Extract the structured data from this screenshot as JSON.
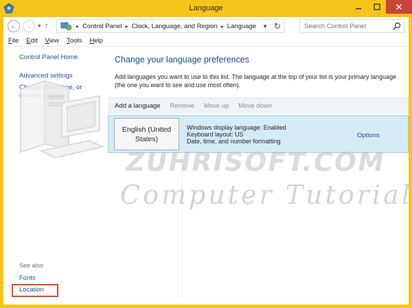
{
  "window": {
    "title": "Language",
    "accent_color": "#f5c518",
    "close_color": "#c7453a"
  },
  "navigation": {
    "breadcrumbs": [
      "Control Panel",
      "Clock, Language, and Region",
      "Language"
    ],
    "search_placeholder": "Search Control Panel"
  },
  "menu": {
    "items": [
      {
        "label": "File",
        "underline": "F",
        "rest": "ile"
      },
      {
        "label": "Edit",
        "underline": "E",
        "rest": "dit"
      },
      {
        "label": "View",
        "underline": "V",
        "rest": "iew"
      },
      {
        "label": "Tools",
        "underline": "T",
        "rest": "ools"
      },
      {
        "label": "Help",
        "underline": "H",
        "rest": "elp"
      }
    ]
  },
  "sidebar": {
    "home": "Control Panel Home",
    "advanced": "Advanced settings",
    "date_time": "Change date, time, or number formats",
    "see_also": "See also",
    "fonts": "Fonts",
    "location": "Location"
  },
  "main": {
    "heading": "Change your language preferences",
    "description": "Add languages you want to use to this list. The language at the top of your list is your primary language (the one you want to see and use most often).",
    "toolbar": {
      "add": "Add a language",
      "remove": "Remove",
      "move_up": "Move up",
      "move_down": "Move down"
    },
    "languages": [
      {
        "name": "English (United States)",
        "info": [
          "Windows display language: Enabled",
          "Keyboard layout: US",
          "Date, time, and number formatting"
        ],
        "options": "Options"
      }
    ]
  },
  "watermark": {
    "line1": "ZUHRISOFT.COM",
    "line2": "Computer Tutorial"
  }
}
